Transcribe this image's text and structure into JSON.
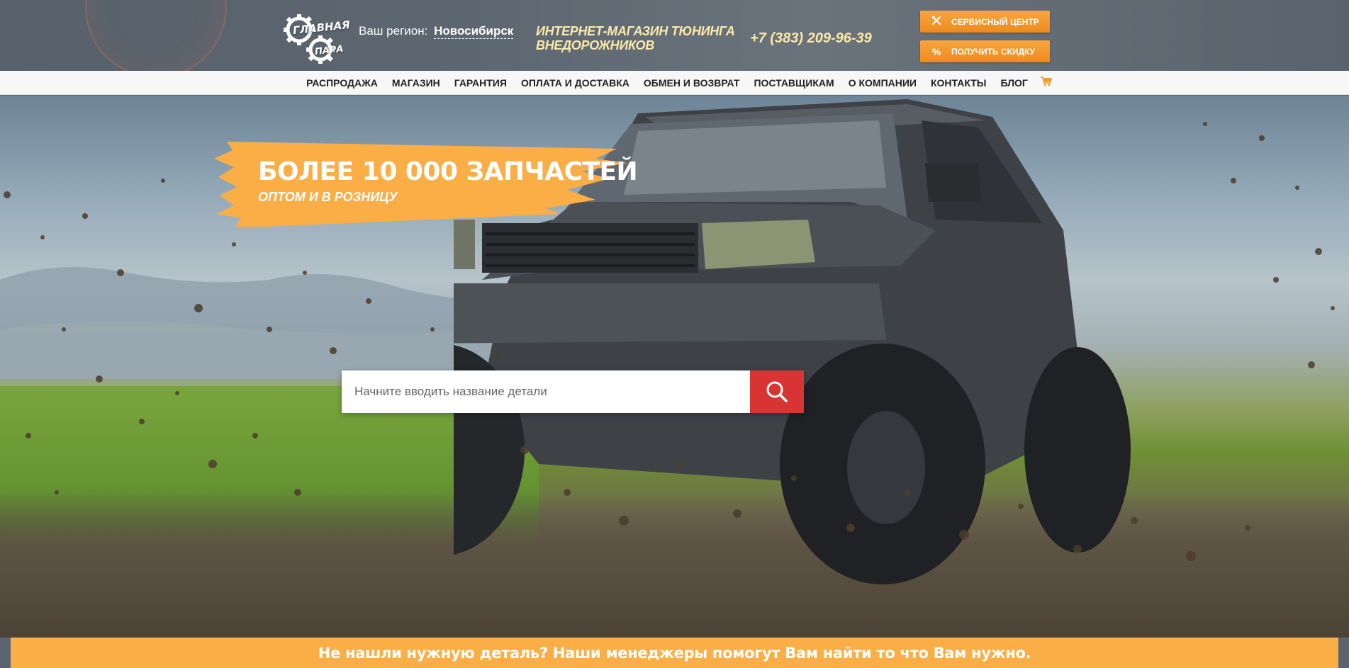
{
  "header": {
    "logo": {
      "word1": "ГЛАВНАЯ",
      "word2": "ПАРА"
    },
    "region": {
      "label": "Ваш регион:",
      "city": "Новосибирск"
    },
    "tagline": "Интернет-магазин тюнинга внедорожников",
    "phone": "+7 (383) 209-96-39",
    "buttons": {
      "service_label": "Сервисный центр",
      "service_icon": "wrench-icon",
      "discount_label": "Получить скидку",
      "discount_icon": "%"
    },
    "accent_color": "#f39a2c"
  },
  "nav": {
    "items": [
      "Распродажа",
      "Магазин",
      "Гарантия",
      "Оплата и доставка",
      "Обмен и возврат",
      "Поставщикам",
      "О компании",
      "Контакты",
      "Блог"
    ],
    "cart_icon": "cart-icon"
  },
  "hero": {
    "promo_title": "БОЛЕЕ 10 000 ЗАПЧАСТЕЙ",
    "promo_subtitle": "ОПТОМ И В РОЗНИЦУ",
    "search": {
      "placeholder": "Начните вводить название детали",
      "value": "",
      "button_icon": "search-icon",
      "button_color": "#d93434"
    }
  },
  "banner": {
    "text": "Не нашли нужную деталь? Наши менеджеры помогут Вам найти то что Вам нужно.",
    "color": "#fbae46"
  }
}
